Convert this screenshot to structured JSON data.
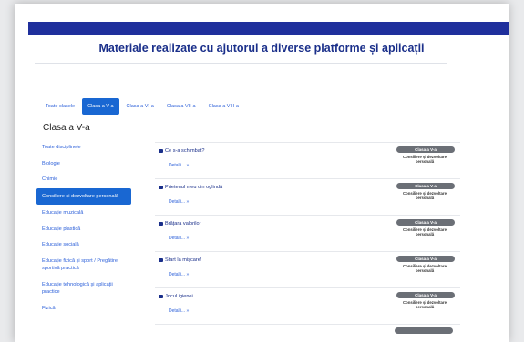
{
  "header": {
    "title": "Materiale realizate cu ajutorul a diverse platforme și aplicații"
  },
  "tabs": [
    {
      "label": "Toate clasele",
      "active": false
    },
    {
      "label": "Clasa a V-a",
      "active": true
    },
    {
      "label": "Clasa a VI-a",
      "active": false
    },
    {
      "label": "Clasa a VII-a",
      "active": false
    },
    {
      "label": "Clasa a VIII-a",
      "active": false
    }
  ],
  "section": {
    "title": "Clasa a V-a"
  },
  "sidebar": {
    "items": [
      {
        "label": "Toate disciplinele",
        "active": false
      },
      {
        "label": "Biologie",
        "active": false
      },
      {
        "label": "Chimie",
        "active": false
      },
      {
        "label": "Consiliere și dezvoltare personală",
        "active": true
      },
      {
        "label": "Educație muzicală",
        "active": false
      },
      {
        "label": "Educație plastică",
        "active": false
      },
      {
        "label": "Educație socială",
        "active": false
      },
      {
        "label": "Educație fizică și sport / Pregătire sportivă practică",
        "active": false
      },
      {
        "label": "Educație tehnologică și aplicații practice",
        "active": false
      },
      {
        "label": "Fizică",
        "active": false
      }
    ]
  },
  "materials": [
    {
      "title": "Ce s-a schimbat?",
      "details": "Detalii... »",
      "badge": "Clasa a V-a",
      "subject": "Consiliere și dezvoltare personală"
    },
    {
      "title": "Prietenul meu din oglindă",
      "details": "Detalii... »",
      "badge": "Clasa a V-a",
      "subject": "Consiliere și dezvoltare personală"
    },
    {
      "title": "Brățara valorilor",
      "details": "Detalii... »",
      "badge": "Clasa a V-a",
      "subject": "Consiliere și dezvoltare personală"
    },
    {
      "title": "Start la mișcare!",
      "details": "Detalii... »",
      "badge": "Clasa a V-a",
      "subject": "Consiliere și dezvoltare personală"
    },
    {
      "title": "Jocul igienei",
      "details": "Detalii... »",
      "badge": "Clasa a V-a",
      "subject": "Consiliere și dezvoltare personală"
    }
  ],
  "colors": {
    "accent": "#1967d2",
    "header_bar": "#1f2f9c",
    "badge": "#6b6f76"
  }
}
